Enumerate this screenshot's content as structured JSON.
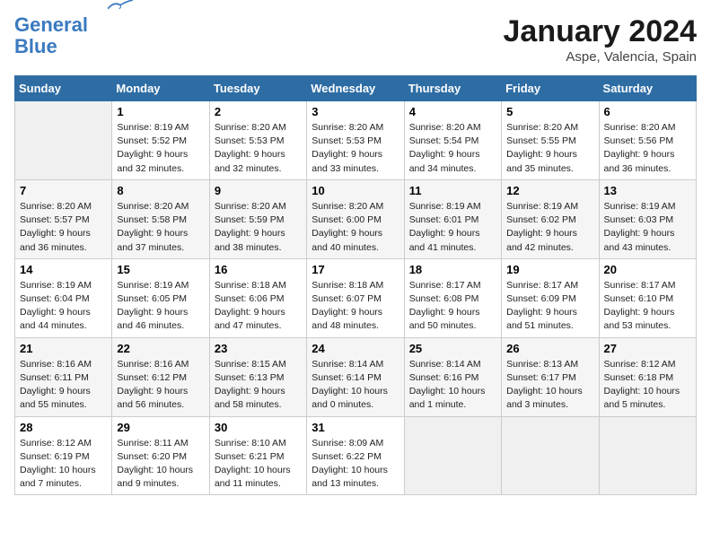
{
  "header": {
    "logo_line1": "General",
    "logo_line2": "Blue",
    "month_year": "January 2024",
    "location": "Aspe, Valencia, Spain"
  },
  "weekdays": [
    "Sunday",
    "Monday",
    "Tuesday",
    "Wednesday",
    "Thursday",
    "Friday",
    "Saturday"
  ],
  "weeks": [
    [
      {
        "day": "",
        "empty": true
      },
      {
        "day": "1",
        "sunrise": "8:19 AM",
        "sunset": "5:52 PM",
        "daylight": "9 hours and 32 minutes."
      },
      {
        "day": "2",
        "sunrise": "8:20 AM",
        "sunset": "5:53 PM",
        "daylight": "9 hours and 32 minutes."
      },
      {
        "day": "3",
        "sunrise": "8:20 AM",
        "sunset": "5:53 PM",
        "daylight": "9 hours and 33 minutes."
      },
      {
        "day": "4",
        "sunrise": "8:20 AM",
        "sunset": "5:54 PM",
        "daylight": "9 hours and 34 minutes."
      },
      {
        "day": "5",
        "sunrise": "8:20 AM",
        "sunset": "5:55 PM",
        "daylight": "9 hours and 35 minutes."
      },
      {
        "day": "6",
        "sunrise": "8:20 AM",
        "sunset": "5:56 PM",
        "daylight": "9 hours and 36 minutes."
      }
    ],
    [
      {
        "day": "7",
        "sunrise": "8:20 AM",
        "sunset": "5:57 PM",
        "daylight": "9 hours and 36 minutes."
      },
      {
        "day": "8",
        "sunrise": "8:20 AM",
        "sunset": "5:58 PM",
        "daylight": "9 hours and 37 minutes."
      },
      {
        "day": "9",
        "sunrise": "8:20 AM",
        "sunset": "5:59 PM",
        "daylight": "9 hours and 38 minutes."
      },
      {
        "day": "10",
        "sunrise": "8:20 AM",
        "sunset": "6:00 PM",
        "daylight": "9 hours and 40 minutes."
      },
      {
        "day": "11",
        "sunrise": "8:19 AM",
        "sunset": "6:01 PM",
        "daylight": "9 hours and 41 minutes."
      },
      {
        "day": "12",
        "sunrise": "8:19 AM",
        "sunset": "6:02 PM",
        "daylight": "9 hours and 42 minutes."
      },
      {
        "day": "13",
        "sunrise": "8:19 AM",
        "sunset": "6:03 PM",
        "daylight": "9 hours and 43 minutes."
      }
    ],
    [
      {
        "day": "14",
        "sunrise": "8:19 AM",
        "sunset": "6:04 PM",
        "daylight": "9 hours and 44 minutes."
      },
      {
        "day": "15",
        "sunrise": "8:19 AM",
        "sunset": "6:05 PM",
        "daylight": "9 hours and 46 minutes."
      },
      {
        "day": "16",
        "sunrise": "8:18 AM",
        "sunset": "6:06 PM",
        "daylight": "9 hours and 47 minutes."
      },
      {
        "day": "17",
        "sunrise": "8:18 AM",
        "sunset": "6:07 PM",
        "daylight": "9 hours and 48 minutes."
      },
      {
        "day": "18",
        "sunrise": "8:17 AM",
        "sunset": "6:08 PM",
        "daylight": "9 hours and 50 minutes."
      },
      {
        "day": "19",
        "sunrise": "8:17 AM",
        "sunset": "6:09 PM",
        "daylight": "9 hours and 51 minutes."
      },
      {
        "day": "20",
        "sunrise": "8:17 AM",
        "sunset": "6:10 PM",
        "daylight": "9 hours and 53 minutes."
      }
    ],
    [
      {
        "day": "21",
        "sunrise": "8:16 AM",
        "sunset": "6:11 PM",
        "daylight": "9 hours and 55 minutes."
      },
      {
        "day": "22",
        "sunrise": "8:16 AM",
        "sunset": "6:12 PM",
        "daylight": "9 hours and 56 minutes."
      },
      {
        "day": "23",
        "sunrise": "8:15 AM",
        "sunset": "6:13 PM",
        "daylight": "9 hours and 58 minutes."
      },
      {
        "day": "24",
        "sunrise": "8:14 AM",
        "sunset": "6:14 PM",
        "daylight": "10 hours and 0 minutes."
      },
      {
        "day": "25",
        "sunrise": "8:14 AM",
        "sunset": "6:16 PM",
        "daylight": "10 hours and 1 minute."
      },
      {
        "day": "26",
        "sunrise": "8:13 AM",
        "sunset": "6:17 PM",
        "daylight": "10 hours and 3 minutes."
      },
      {
        "day": "27",
        "sunrise": "8:12 AM",
        "sunset": "6:18 PM",
        "daylight": "10 hours and 5 minutes."
      }
    ],
    [
      {
        "day": "28",
        "sunrise": "8:12 AM",
        "sunset": "6:19 PM",
        "daylight": "10 hours and 7 minutes."
      },
      {
        "day": "29",
        "sunrise": "8:11 AM",
        "sunset": "6:20 PM",
        "daylight": "10 hours and 9 minutes."
      },
      {
        "day": "30",
        "sunrise": "8:10 AM",
        "sunset": "6:21 PM",
        "daylight": "10 hours and 11 minutes."
      },
      {
        "day": "31",
        "sunrise": "8:09 AM",
        "sunset": "6:22 PM",
        "daylight": "10 hours and 13 minutes."
      },
      {
        "day": "",
        "empty": true
      },
      {
        "day": "",
        "empty": true
      },
      {
        "day": "",
        "empty": true
      }
    ]
  ]
}
